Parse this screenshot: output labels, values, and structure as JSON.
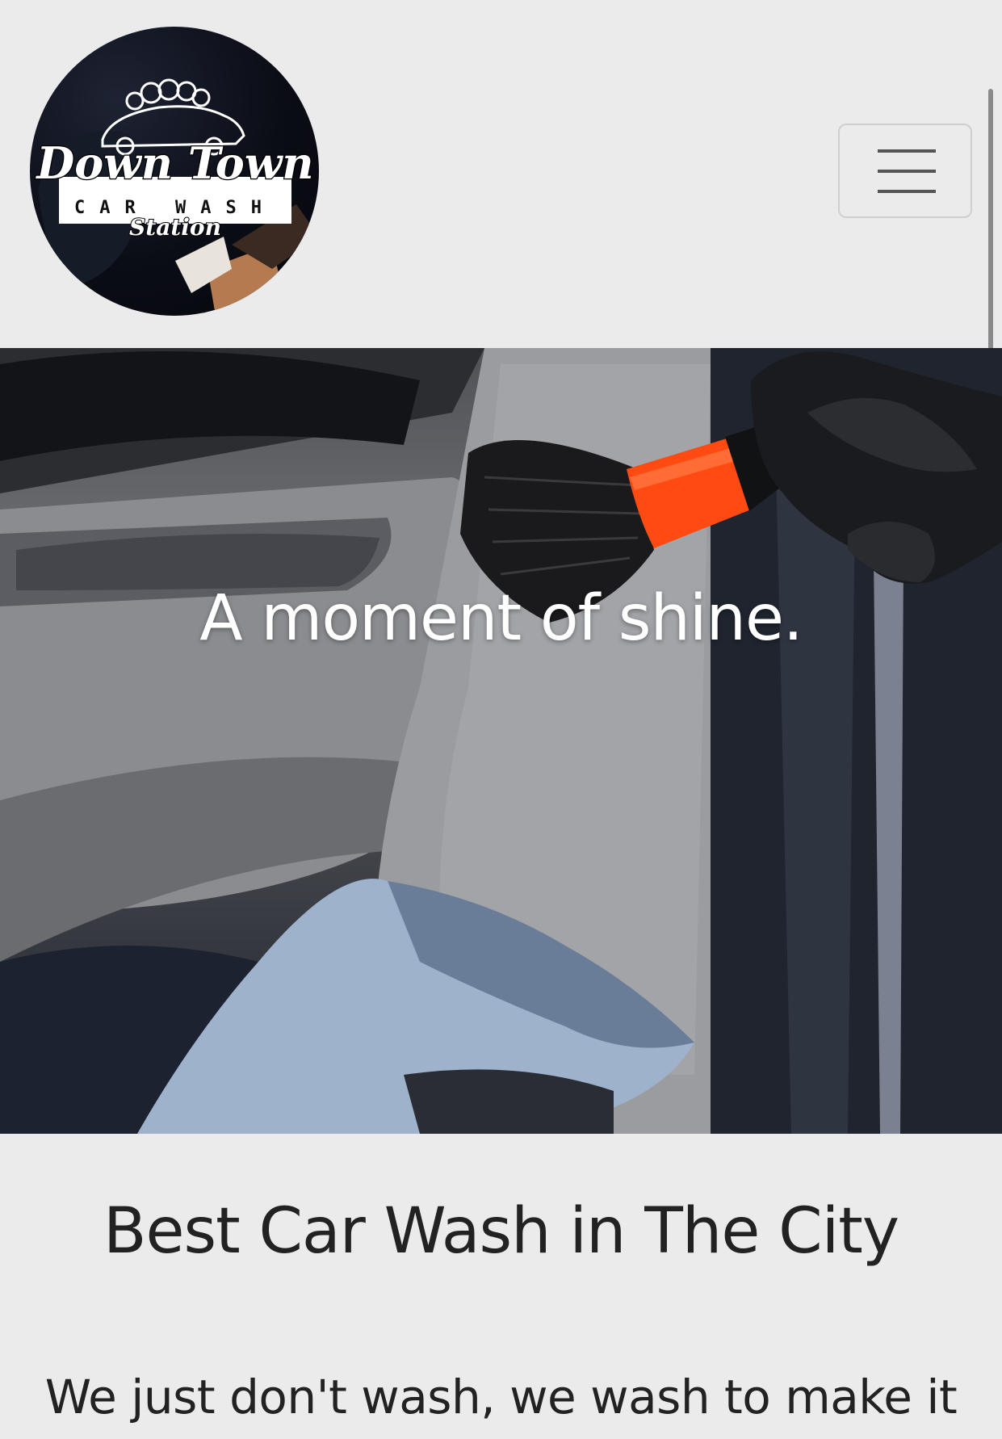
{
  "header": {
    "logo": {
      "line1": "Down Town",
      "line2": "CAR WASH",
      "line3": "Station"
    },
    "menu_button_icon": "hamburger-menu-icon"
  },
  "hero": {
    "title": "A moment of shine."
  },
  "main": {
    "headline": "Best Car Wash in The City",
    "tagline": "We just don't wash, we wash to make it"
  },
  "colors": {
    "background": "#ebebeb",
    "text": "#222222",
    "brush_accent": "#ff4a12",
    "hero_text": "#ffffff"
  }
}
